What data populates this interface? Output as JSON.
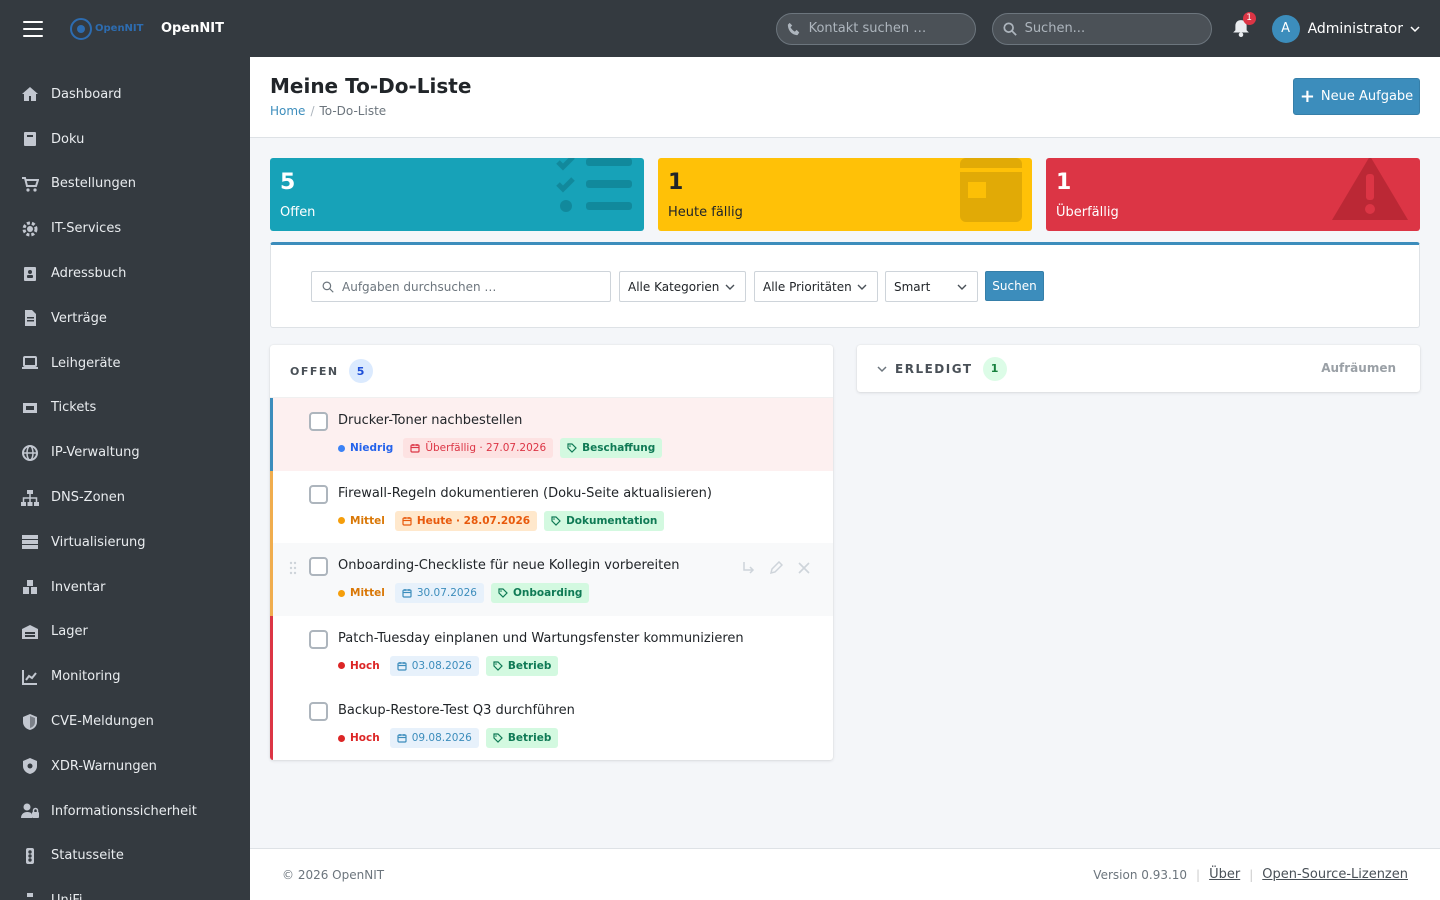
{
  "app": {
    "brand_name": "OpenNIT",
    "logo_text": "OpenNIT"
  },
  "topbar": {
    "contact_search_placeholder": "Kontakt suchen …",
    "search_placeholder": "Suchen...",
    "notification_count": "1",
    "user_initial": "A",
    "user_name": "Administrator"
  },
  "sidebar": {
    "items": [
      {
        "label": "Dashboard",
        "icon": "home-icon"
      },
      {
        "label": "Doku",
        "icon": "book-icon"
      },
      {
        "label": "Bestellungen",
        "icon": "cart-icon"
      },
      {
        "label": "IT-Services",
        "icon": "gear-icon"
      },
      {
        "label": "Adressbuch",
        "icon": "address-book-icon"
      },
      {
        "label": "Verträge",
        "icon": "document-icon"
      },
      {
        "label": "Leihgeräte",
        "icon": "laptop-icon"
      },
      {
        "label": "Tickets",
        "icon": "ticket-icon"
      },
      {
        "label": "IP-Verwaltung",
        "icon": "globe-icon"
      },
      {
        "label": "DNS-Zonen",
        "icon": "sitemap-icon"
      },
      {
        "label": "Virtualisierung",
        "icon": "server-icon"
      },
      {
        "label": "Inventar",
        "icon": "cubes-icon"
      },
      {
        "label": "Lager",
        "icon": "warehouse-icon"
      },
      {
        "label": "Monitoring",
        "icon": "chart-line-icon"
      },
      {
        "label": "CVE-Meldungen",
        "icon": "shield-icon"
      },
      {
        "label": "XDR-Warnungen",
        "icon": "shield-virus-icon"
      },
      {
        "label": "Informationssicherheit",
        "icon": "user-lock-icon"
      },
      {
        "label": "Statusseite",
        "icon": "traffic-light-icon"
      },
      {
        "label": "UniFi",
        "icon": "network-icon"
      }
    ]
  },
  "header": {
    "title": "Meine To-Do-Liste",
    "breadcrumb": [
      "Home",
      "To-Do-Liste"
    ],
    "new_task_label": "Neue Aufgabe"
  },
  "stats": [
    {
      "value": "5",
      "label": "Offen",
      "icon": "list-check-icon"
    },
    {
      "value": "1",
      "label": "Heute fällig",
      "icon": "calendar-icon"
    },
    {
      "value": "1",
      "label": "Überfällig",
      "icon": "warning-icon"
    }
  ],
  "filters": {
    "search_placeholder": "Aufgaben durchsuchen …",
    "category": "Alle Kategorien",
    "priority": "Alle Prioritäten",
    "sort": "Smart",
    "submit_label": "Suchen"
  },
  "open_section": {
    "title": "OFFEN",
    "count": "5",
    "tasks": [
      {
        "title": "Drucker-Toner nachbestellen",
        "priority": "Niedrig",
        "date": "Überfällig · 27.07.2026",
        "tag": "Beschaffung"
      },
      {
        "title": "Firewall-Regeln dokumentieren (Doku-Seite aktualisieren)",
        "priority": "Mittel",
        "date": "Heute · 28.07.2026",
        "tag": "Dokumentation"
      },
      {
        "title": "Onboarding-Checkliste für neue Kollegin vorbereiten",
        "priority": "Mittel",
        "date": "30.07.2026",
        "tag": "Onboarding"
      },
      {
        "title": "Patch-Tuesday einplanen und Wartungsfenster kommunizieren",
        "priority": "Hoch",
        "date": "03.08.2026",
        "tag": "Betrieb"
      },
      {
        "title": "Backup-Restore-Test Q3 durchführen",
        "priority": "Hoch",
        "date": "09.08.2026",
        "tag": "Betrieb"
      }
    ]
  },
  "done_section": {
    "title": "ERLEDIGT",
    "count": "1",
    "cleanup_label": "Aufräumen"
  },
  "footer": {
    "copyright": "© 2026 OpenNIT",
    "version": "Version 0.93.10",
    "about_label": "Über",
    "licenses_label": "Open-Source-Lizenzen"
  },
  "colors": {
    "primary": "#3c8dbc",
    "info": "#17a2b8",
    "warning": "#ffc107",
    "danger": "#dc3545",
    "sidebar": "#343a40"
  }
}
